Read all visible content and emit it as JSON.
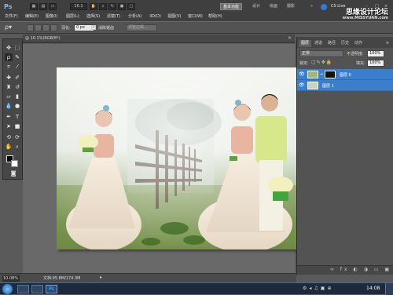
{
  "app": {
    "logo": "Ps",
    "zoom": "16.1",
    "workspace_button": "基本功能",
    "workspace_links": [
      "设计",
      "绘画",
      "摄影"
    ],
    "cs_live": "CS Live",
    "watermark": "思缘设计论坛",
    "watermark_url": "www.MISSYUAN.com"
  },
  "menu": [
    "文件(F)",
    "编辑(E)",
    "图像(I)",
    "图层(L)",
    "选择(S)",
    "滤镜(T)",
    "分析(A)",
    "3D(D)",
    "视图(V)",
    "窗口(W)",
    "帮助(H)"
  ],
  "options": {
    "feather_label": "羽化:",
    "feather_value": "0 px",
    "antialias_label": "消除锯齿",
    "refine_edge": "调整边缘..."
  },
  "document": {
    "title": "@ 10.1%(RGB/8*)"
  },
  "panel": {
    "tabs": [
      "图层",
      "通道",
      "路径",
      "历史",
      "动作"
    ],
    "blend_mode": "正常",
    "opacity_label": "不透明度:",
    "opacity_value": "100%",
    "lock_label": "锁定:",
    "fill_label": "填充:",
    "fill_value": "100%",
    "layers": [
      {
        "name": "图层 0"
      },
      {
        "name": "图层 1"
      }
    ]
  },
  "status": {
    "zoom": "10.08%",
    "doc_size": "文档:95.8M/174.3M"
  },
  "taskbar": {
    "time": "14:08"
  },
  "colors": {
    "selection": "#3b7fcc",
    "app_bg": "#5a5a5a",
    "menubar": "#3f3f3f"
  }
}
